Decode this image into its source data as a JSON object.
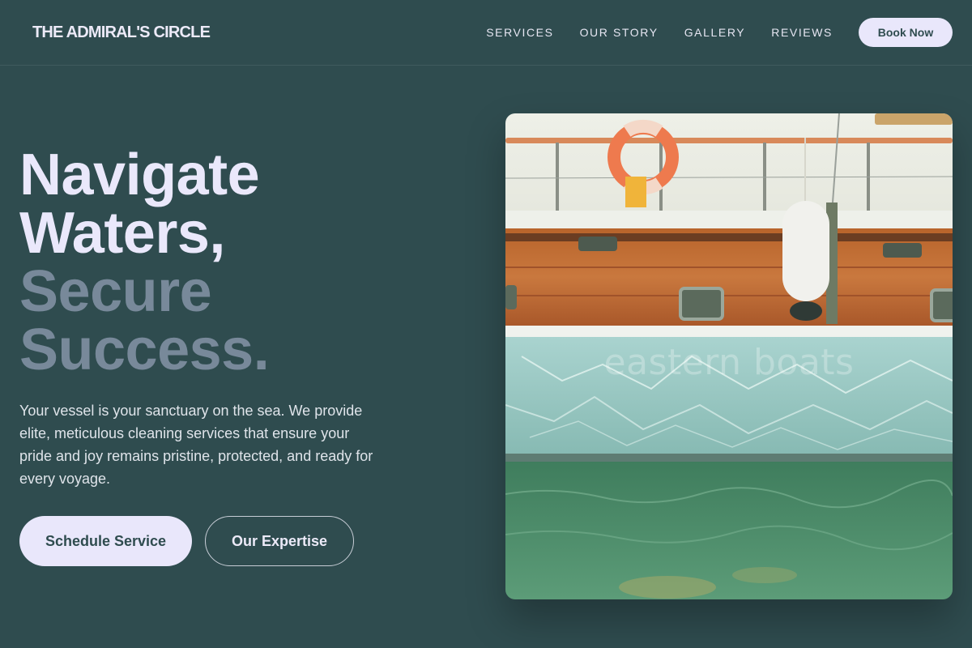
{
  "brand": "THE ADMIRAL'S CIRCLE",
  "nav": {
    "items": [
      "SERVICES",
      "OUR STORY",
      "GALLERY",
      "REVIEWS"
    ],
    "cta_label": "Book Now"
  },
  "hero": {
    "title_line1": "Navigate",
    "title_line2": "Waters,",
    "title_line3": "Secure",
    "title_line4": "Success.",
    "description": "Your vessel is your sanctuary on the sea. We provide elite, meticulous cleaning services that ensure your pride and joy remains pristine, protected, and ready for every voyage.",
    "primary_cta": "Schedule Service",
    "secondary_cta": "Our Expertise",
    "image_watermark": "eastern boats"
  },
  "colors": {
    "background": "#2f4c4f",
    "accent_light": "#e9e7fb",
    "muted_heading": "#78899a"
  }
}
